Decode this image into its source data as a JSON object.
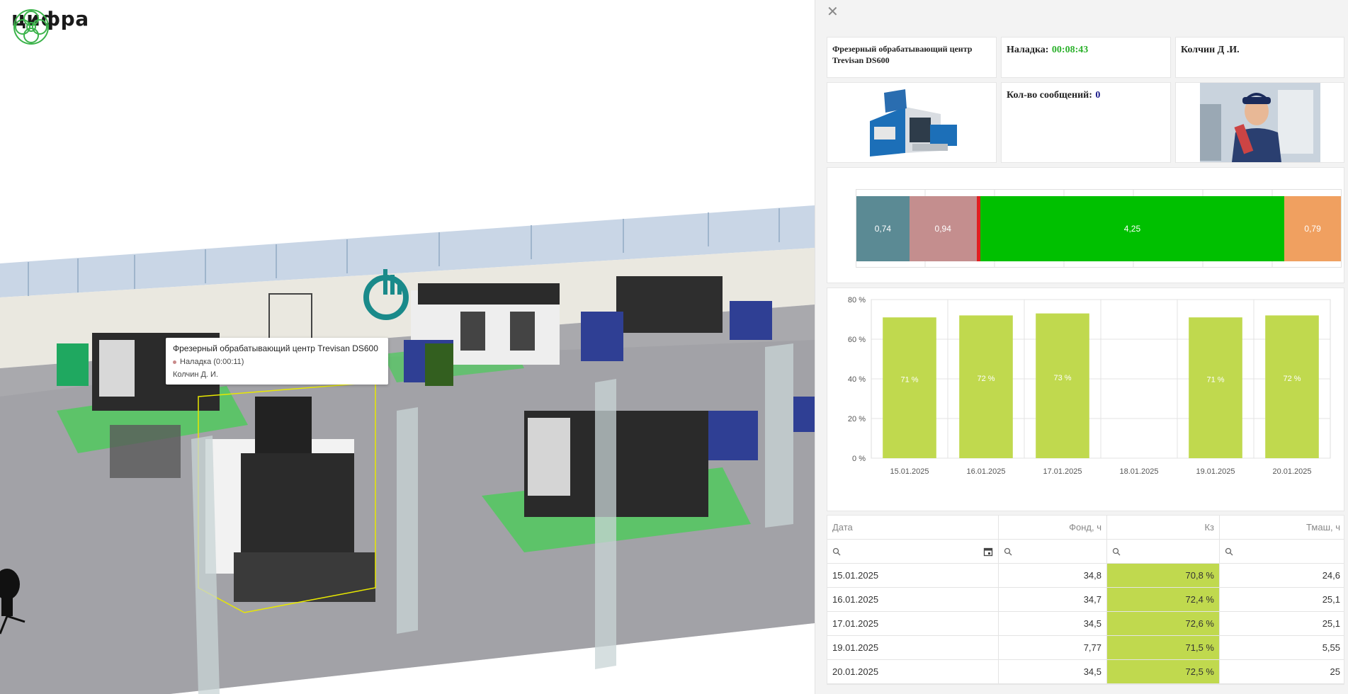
{
  "brand": {
    "name": "цифра",
    "color": "#3bb34a"
  },
  "tooltip": {
    "title": "Фрезерный обрабатывающий центр Trevisan DS600",
    "status": "Наладка (0:00:11)",
    "operator": "Колчин Д. И."
  },
  "panel": {
    "machine_name": "Фрезерный обрабатывающий центр Trevisan DS600",
    "setup_label": "Наладка:",
    "setup_value": "00:08:43",
    "operator": "Колчин Д .И.",
    "messages_label": "Кол-во сообщений:",
    "messages_value": "0"
  },
  "timeline": {
    "segments": [
      {
        "label": "0,74",
        "value": 0.74,
        "color": "#5b8a94"
      },
      {
        "label": "0,94",
        "value": 0.94,
        "color": "#c48e8e"
      },
      {
        "label": "",
        "value": 0.05,
        "color": "#e02020"
      },
      {
        "label": "4,25",
        "value": 4.25,
        "color": "#00c000"
      },
      {
        "label": "0,79",
        "value": 0.79,
        "color": "#f0a060"
      }
    ]
  },
  "chart_data": {
    "type": "bar",
    "categories": [
      "15.01.2025",
      "16.01.2025",
      "17.01.2025",
      "18.01.2025",
      "19.01.2025",
      "20.01.2025"
    ],
    "values": [
      71,
      72,
      73,
      null,
      71,
      72
    ],
    "data_labels": [
      "71 %",
      "72 %",
      "73 %",
      "",
      "71 %",
      "72 %"
    ],
    "ylim": [
      0,
      80
    ],
    "yticks": [
      "0 %",
      "20 %",
      "40 %",
      "60 %",
      "80 %"
    ],
    "bar_color": "#c0d94e",
    "grid": true
  },
  "table": {
    "headers": [
      "Дата",
      "Фонд, ч",
      "Кз",
      "Тмаш, ч"
    ],
    "rows": [
      [
        "15.01.2025",
        "34,8",
        "70,8 %",
        "24,6"
      ],
      [
        "16.01.2025",
        "34,7",
        "72,4 %",
        "25,1"
      ],
      [
        "17.01.2025",
        "34,5",
        "72,6 %",
        "25,1"
      ],
      [
        "19.01.2025",
        "7,77",
        "71,5 %",
        "5,55"
      ],
      [
        "20.01.2025",
        "34,5",
        "72,5 %",
        "25"
      ]
    ]
  }
}
